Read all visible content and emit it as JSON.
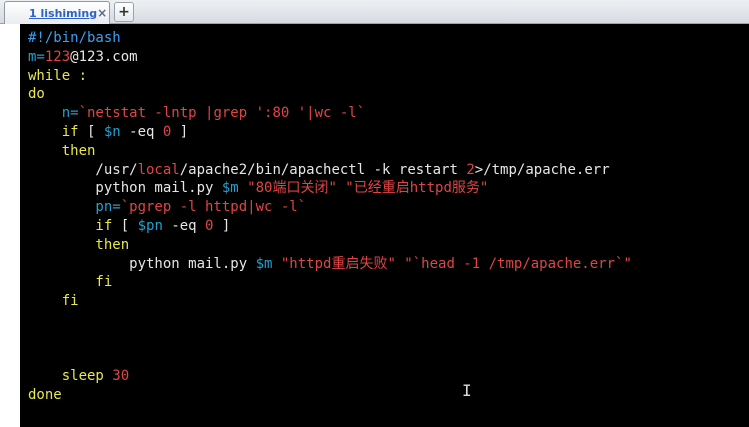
{
  "tab": {
    "label": "1 lishiming",
    "close_icon": "×",
    "new_tab_icon": "+"
  },
  "code_lines": [
    [
      {
        "t": "#!/bin/bash",
        "c": "c"
      }
    ],
    [
      {
        "t": "m=",
        "c": "v"
      },
      {
        "t": "123",
        "c": "s"
      },
      {
        "t": "@123.com",
        "c": "w"
      }
    ],
    [
      {
        "t": "while :",
        "c": "k"
      }
    ],
    [
      {
        "t": "do",
        "c": "k"
      }
    ],
    [
      {
        "t": "    n=",
        "c": "v"
      },
      {
        "t": "`netstat -lntp |grep ':80 '|wc -l`",
        "c": "s"
      }
    ],
    [
      {
        "t": "    if",
        "c": "k"
      },
      {
        "t": " [ ",
        "c": "w"
      },
      {
        "t": "$n",
        "c": "v"
      },
      {
        "t": " -eq ",
        "c": "w"
      },
      {
        "t": "0",
        "c": "s"
      },
      {
        "t": " ]",
        "c": "w"
      }
    ],
    [
      {
        "t": "    then",
        "c": "k"
      }
    ],
    [
      {
        "t": "        /usr/",
        "c": "w"
      },
      {
        "t": "local",
        "c": "s"
      },
      {
        "t": "/apache2/bin/apachectl ",
        "c": "w"
      },
      {
        "t": "-k",
        "c": "w"
      },
      {
        "t": " restart ",
        "c": "w"
      },
      {
        "t": "2",
        "c": "s"
      },
      {
        "t": ">/tmp/apache.err",
        "c": "w"
      }
    ],
    [
      {
        "t": "        python mail.py ",
        "c": "w"
      },
      {
        "t": "$m",
        "c": "v"
      },
      {
        "t": " \"80端口关闭\" \"已经重启httpd服务\"",
        "c": "s"
      }
    ],
    [
      {
        "t": "        pn=",
        "c": "v"
      },
      {
        "t": "`pgrep -l httpd|wc -l`",
        "c": "s"
      }
    ],
    [
      {
        "t": "        if",
        "c": "k"
      },
      {
        "t": " [ ",
        "c": "w"
      },
      {
        "t": "$pn",
        "c": "v"
      },
      {
        "t": " -eq ",
        "c": "w"
      },
      {
        "t": "0",
        "c": "s"
      },
      {
        "t": " ]",
        "c": "w"
      }
    ],
    [
      {
        "t": "        then",
        "c": "k"
      }
    ],
    [
      {
        "t": "            python mail.py ",
        "c": "w"
      },
      {
        "t": "$m",
        "c": "v"
      },
      {
        "t": " \"httpd重启失败\" \"`head -1 /tmp/apache.err`\"",
        "c": "s"
      }
    ],
    [
      {
        "t": "        fi",
        "c": "k"
      }
    ],
    [
      {
        "t": "    fi",
        "c": "k"
      }
    ],
    [
      {
        "t": "",
        "c": "w"
      }
    ],
    [
      {
        "t": "",
        "c": "w"
      }
    ],
    [
      {
        "t": "",
        "c": "w"
      }
    ],
    [
      {
        "t": "    sleep ",
        "c": "k"
      },
      {
        "t": "30",
        "c": "s"
      }
    ],
    [
      {
        "t": "done",
        "c": "k"
      }
    ]
  ],
  "mouse_cursor": "I"
}
